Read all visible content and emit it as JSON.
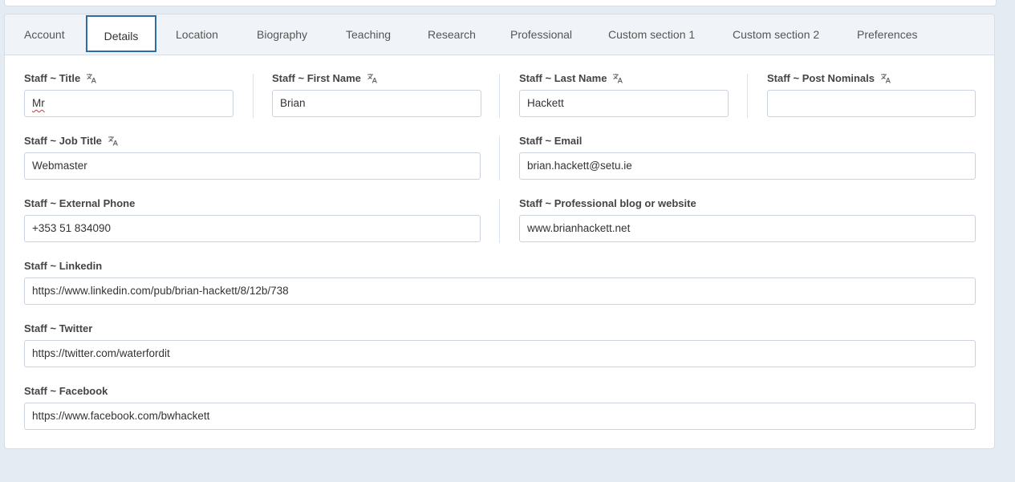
{
  "tabs": [
    {
      "label": "Account"
    },
    {
      "label": "Details"
    },
    {
      "label": "Location"
    },
    {
      "label": "Biography"
    },
    {
      "label": "Teaching"
    },
    {
      "label": "Research"
    },
    {
      "label": "Professional"
    },
    {
      "label": "Custom section 1"
    },
    {
      "label": "Custom section 2"
    },
    {
      "label": "Preferences"
    }
  ],
  "active_tab": "Details",
  "icons": {
    "translate": "translate-icon"
  },
  "colors": {
    "active_tab_border": "#2e6da4",
    "background": "#e4ebf3"
  },
  "fields": {
    "title": {
      "label": "Staff ~ Title",
      "value": "Mr"
    },
    "first_name": {
      "label": "Staff ~ First Name",
      "value": "Brian"
    },
    "last_name": {
      "label": "Staff ~ Last Name",
      "value": "Hackett"
    },
    "post_nominals": {
      "label": "Staff ~ Post Nominals",
      "value": ""
    },
    "job_title": {
      "label": "Staff ~ Job Title",
      "value": "Webmaster"
    },
    "email": {
      "label": "Staff ~ Email",
      "value": "brian.hackett@setu.ie"
    },
    "external_phone": {
      "label": "Staff ~ External Phone",
      "value": "+353 51 834090"
    },
    "blog": {
      "label": "Staff ~ Professional blog or website",
      "value": "www.brianhackett.net"
    },
    "linkedin": {
      "label": "Staff ~ Linkedin",
      "value": "https://www.linkedin.com/pub/brian-hackett/8/12b/738"
    },
    "twitter": {
      "label": "Staff ~ Twitter",
      "value": "https://twitter.com/waterfordit"
    },
    "facebook": {
      "label": "Staff ~ Facebook",
      "value": "https://www.facebook.com/bwhackett"
    }
  }
}
